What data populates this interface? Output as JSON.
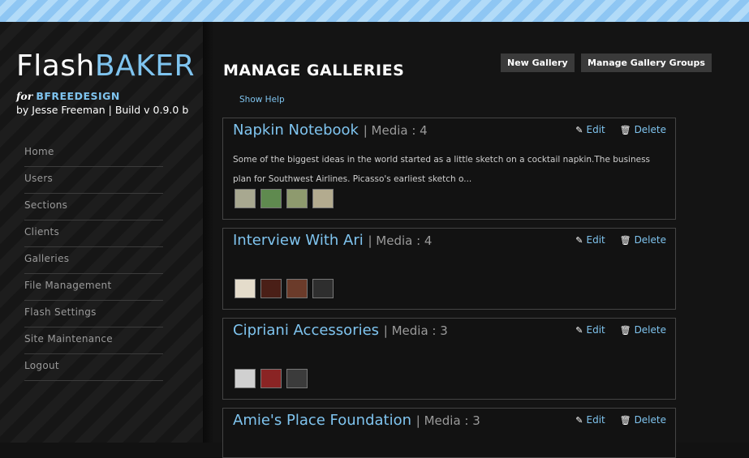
{
  "logo": {
    "part1": "Flash",
    "part2": "BAKER"
  },
  "tagline": {
    "prefix": "for",
    "client": "BFREEDESIGN"
  },
  "byline": "by Jesse Freeman | Build v 0.9.0 b",
  "nav": [
    {
      "label": "Home"
    },
    {
      "label": "Users"
    },
    {
      "label": "Sections"
    },
    {
      "label": "Clients"
    },
    {
      "label": "Galleries"
    },
    {
      "label": "File Management"
    },
    {
      "label": "Flash Settings"
    },
    {
      "label": "Site Maintenance"
    },
    {
      "label": "Logout"
    }
  ],
  "page": {
    "title": "MANAGE GALLERIES",
    "new_gallery": "New Gallery",
    "manage_groups": "Manage Gallery Groups",
    "show_help": "Show Help"
  },
  "galleries": [
    {
      "name": "Napkin Notebook",
      "media": "| Media : 4",
      "description": "Some of the biggest ideas in the world started as a little sketch on a cocktail napkin.The business plan for Southwest Airlines. Picasso's earliest sketch o...",
      "edit": "Edit",
      "delete": "Delete",
      "thumbs": [
        "#a8a890",
        "#5f8a4f",
        "#8e9a6e",
        "#b3ab8f"
      ]
    },
    {
      "name": "Interview With Ari",
      "media": "| Media : 4",
      "description": "",
      "edit": "Edit",
      "delete": "Delete",
      "thumbs": [
        "#e4dccb",
        "#4a1f17",
        "#6b3b2a",
        "#2e2e2e"
      ]
    },
    {
      "name": "Cipriani Accessories",
      "media": "| Media : 3",
      "description": "",
      "edit": "Edit",
      "delete": "Delete",
      "thumbs": [
        "#d0d0d0",
        "#8a2424",
        "#3b3b3b"
      ]
    },
    {
      "name": "Amie's Place Foundation",
      "media": "| Media : 3",
      "description": "",
      "edit": "Edit",
      "delete": "Delete",
      "thumbs": []
    }
  ],
  "colors": {
    "accent": "#7fc4ef",
    "background": "#121212",
    "topbar": "#8ec6f3"
  }
}
